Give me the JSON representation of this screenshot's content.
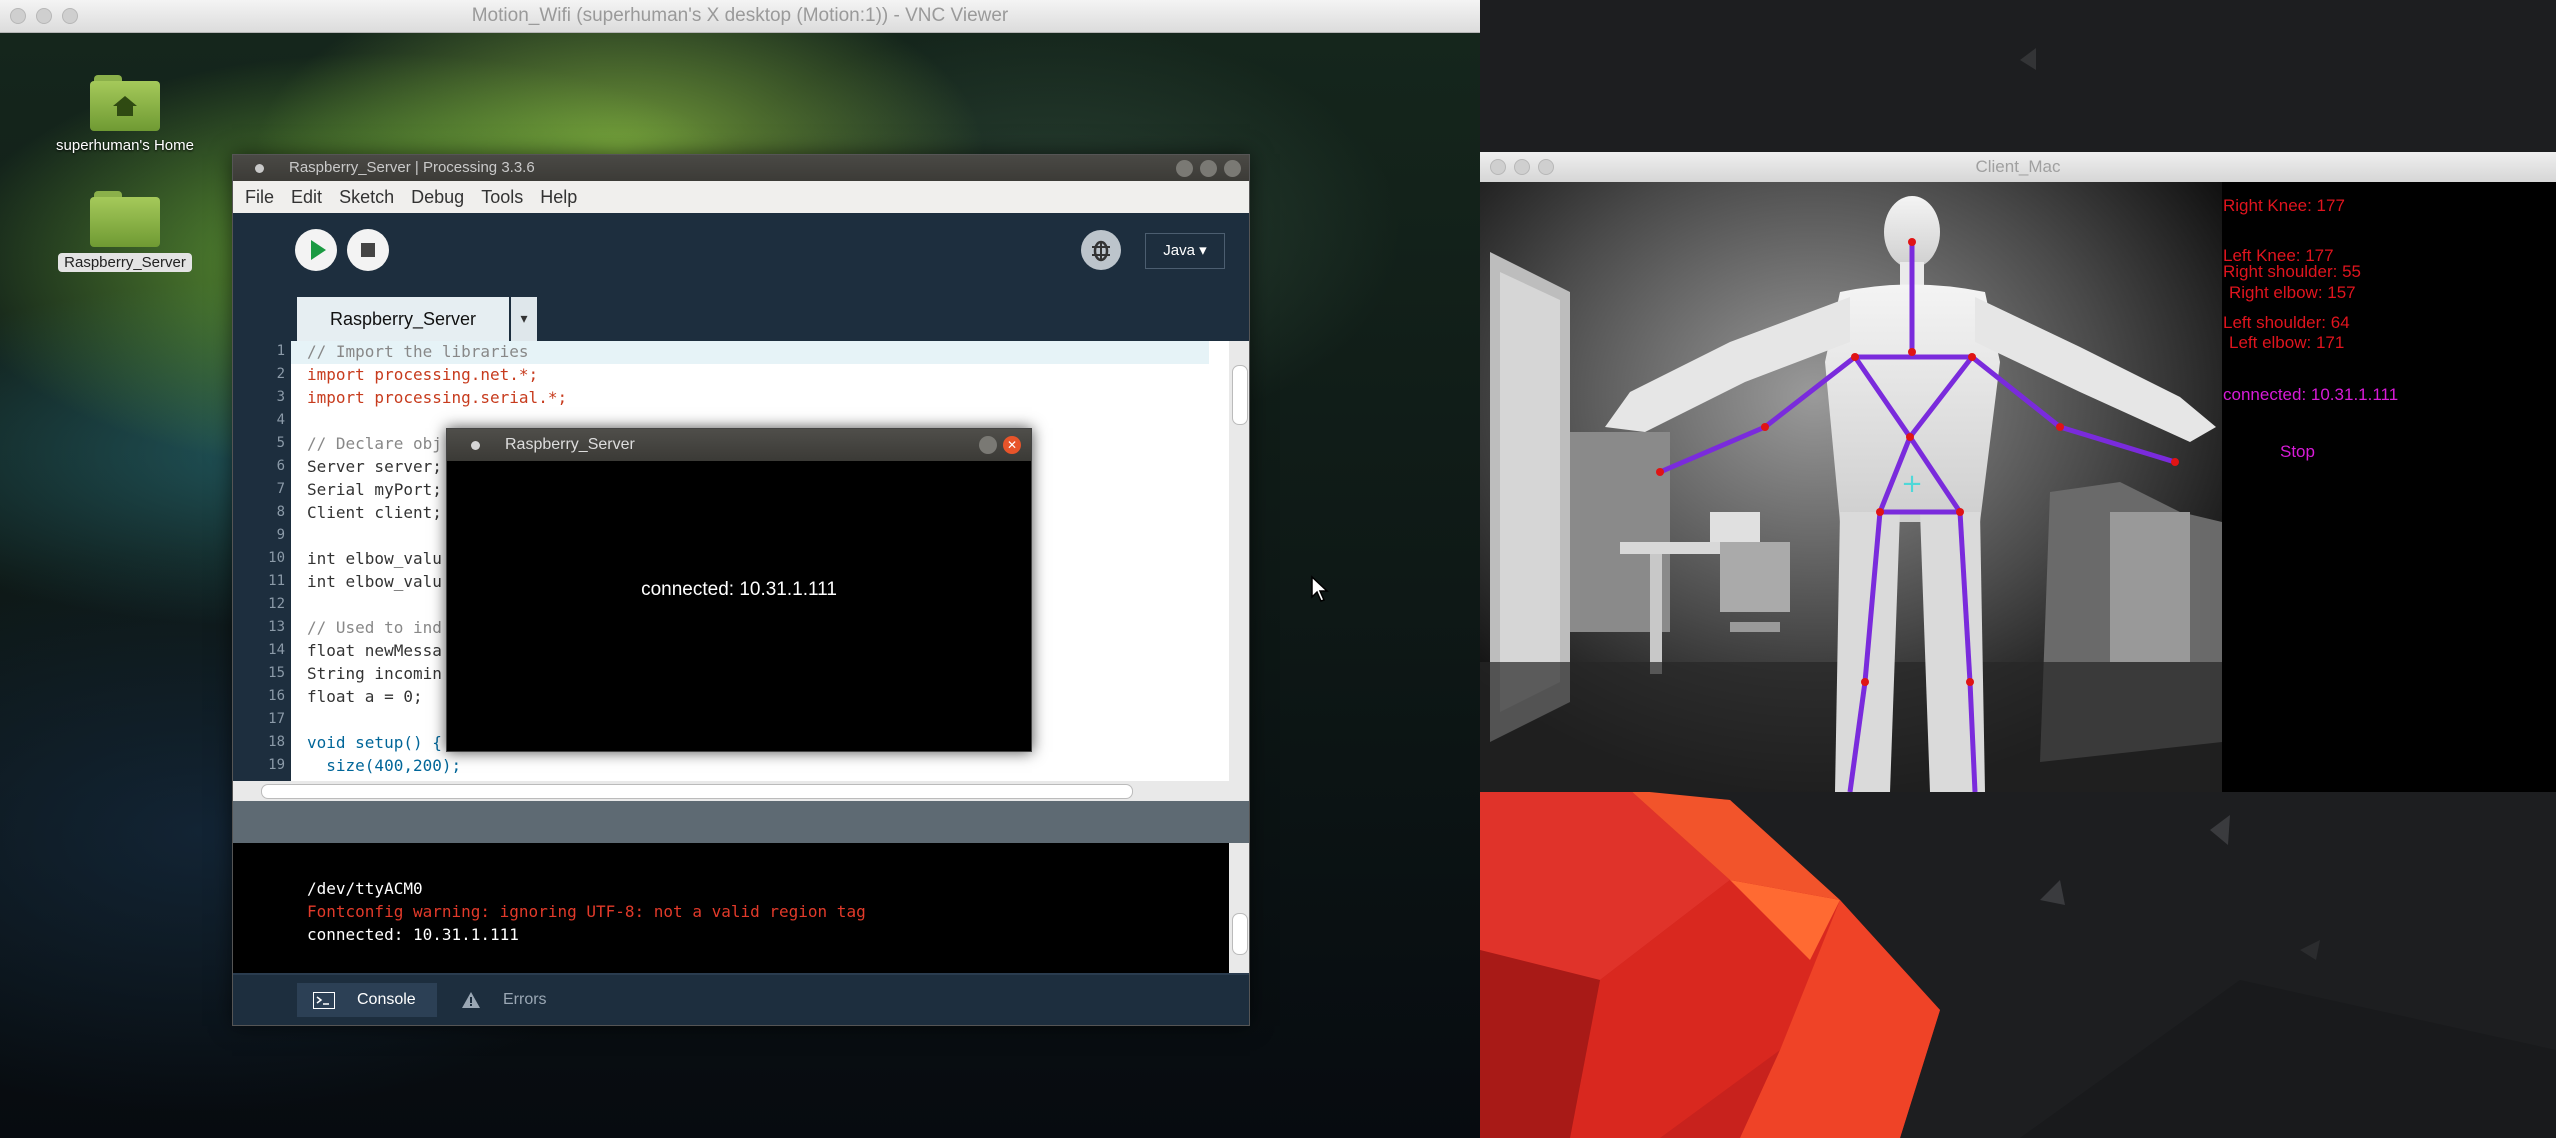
{
  "vnc": {
    "title": "Motion_Wifi (superhuman's X desktop (Motion:1)) - VNC Viewer"
  },
  "desktop_icons": [
    {
      "label": "superhuman's Home"
    },
    {
      "label": "Raspberry_Server"
    }
  ],
  "ide": {
    "title": "Raspberry_Server | Processing 3.3.6",
    "menu": [
      "File",
      "Edit",
      "Sketch",
      "Debug",
      "Tools",
      "Help"
    ],
    "mode": "Java ▾",
    "tab": "Raspberry_Server",
    "line_numbers": [
      "1",
      "2",
      "3",
      "4",
      "5",
      "6",
      "7",
      "8",
      "9",
      "10",
      "11",
      "12",
      "13",
      "14",
      "15",
      "16",
      "17",
      "18",
      "19"
    ],
    "code": [
      "// Import the libraries",
      "import processing.net.*;",
      "import processing.serial.*;",
      "",
      "// Declare obj",
      "Server server;",
      "Serial myPort;",
      "Client client;",
      "",
      "int elbow_valu",
      "int elbow_valu",
      "",
      "// Used to ind",
      "float newMessa",
      "String incomin",
      "float a = 0;",
      "",
      "void setup() {",
      "  size(400,200);"
    ],
    "console": [
      "/dev/ttyACM0",
      "Fontconfig warning: ignoring UTF-8: not a valid region tag",
      "connected: 10.31.1.111"
    ],
    "console_tab": "Console",
    "errors_tab": "Errors"
  },
  "sketch": {
    "title": "Raspberry_Server",
    "message": "connected: 10.31.1.111"
  },
  "client": {
    "title": "Client_Mac",
    "right_knee": "Right Knee: 177",
    "left_knee": "Left Knee: 177",
    "right_shoulder": "Right shoulder: 55",
    "right_elbow": "Right elbow: 157",
    "left_shoulder": "Left shoulder: 64",
    "left_elbow": "Left elbow: 171",
    "connected": "connected: 10.31.1.111",
    "stop": "Stop"
  },
  "colors": {
    "overlay_red": "#e0141e",
    "overlay_magenta": "#d81bd8",
    "skeleton": "#7a2bdc",
    "joint": "#e01414",
    "console_error": "#e23a2a"
  },
  "icons": [
    "home-folder-icon",
    "folder-icon",
    "run-icon",
    "stop-icon",
    "debug-icon",
    "console-icon",
    "warning-icon",
    "mouse-cursor-icon"
  ]
}
